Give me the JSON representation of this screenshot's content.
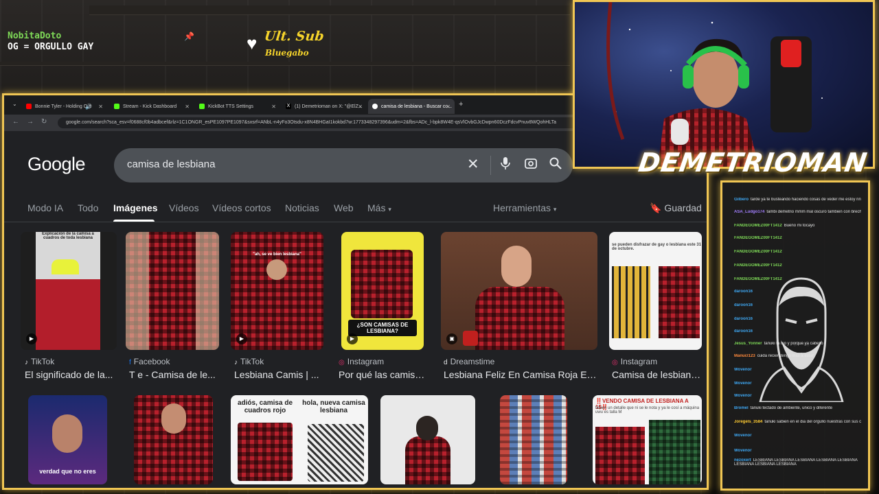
{
  "overlay": {
    "chat_user": "NobitaDoto",
    "chat_message": "OG = ORGULLO GAY",
    "ult_sub_label": "Ult. Sub",
    "ult_sub_name": "Bluegabo",
    "streamer_name": "DEMETRIOMAN",
    "colors": {
      "frame": "#f0c654",
      "chat_user": "#7ed957",
      "ult_sub": "#f6d42b"
    }
  },
  "browser": {
    "tabs": [
      {
        "title": "Bonnie Tyler - Holding Out",
        "icon": "youtube-icon",
        "color": "#ff0000"
      },
      {
        "title": "Stream - Kick Dashboard",
        "icon": "kick-icon",
        "color": "#53fc18"
      },
      {
        "title": "KickBot TTS Settings",
        "icon": "kickbot-icon",
        "color": "#53fc18"
      },
      {
        "title": "(1) Demetrioman on X: \"@ElZ...",
        "icon": "x-icon",
        "color": "#ffffff"
      },
      {
        "title": "camisa de lesbiana - Buscar co...",
        "icon": "google-icon",
        "color": "#4285f4"
      }
    ],
    "url": "google.com/search?sca_esv=f0688cf0b4adbcef&rlz=1C1ONGR_esPE1097PE1097&sxsrf=ANbL-n4yFo3Otsdu-x8N4BHGaI1kokbd7w:1773348297396&udm=2&fbs=ADc_l-bpk8W4E-qsVlOvbGJcDwpn60DczFdcvPnuv8WQohHLTa"
  },
  "google": {
    "logo": "Google",
    "query": "camisa de lesbiana",
    "nav_tabs": [
      "Modo IA",
      "Todo",
      "Imágenes",
      "Vídeos",
      "Vídeos cortos",
      "Noticias",
      "Web",
      "Más"
    ],
    "active_tab": "Imágenes",
    "tools_label": "Herramientas",
    "saved_label": "Guardad",
    "results_row1": [
      {
        "source": "TikTok",
        "source_icon": "tiktok-icon",
        "title": "El significado de la...",
        "caption": "Explicación de la camisa a cuadros de toda lesbiana"
      },
      {
        "source": "Facebook",
        "source_icon": "facebook-icon",
        "title": "T e - Camisa de le..."
      },
      {
        "source": "TikTok",
        "source_icon": "tiktok-icon",
        "title": "Lesbiana Camis | ...",
        "caption": "\"ah, se ve bien lesbiana\""
      },
      {
        "source": "Instagram",
        "source_icon": "instagram-icon",
        "title": "Por qué las camisa...",
        "caption": "¿SON CAMISAS DE LESBIANA?"
      },
      {
        "source": "Dreamstime",
        "source_icon": "dreamstime-icon",
        "title": "Lesbiana Feliz En Camisa Roja En..."
      },
      {
        "source": "Instagram",
        "source_icon": "instagram-icon",
        "title": "Camisa de lesbiana ...",
        "caption": "se pueden disfrazar de gay o lesbiana este 31 de octubre."
      }
    ],
    "results_row2": [
      {
        "caption": "verdad que no eres"
      },
      {
        "caption": ""
      },
      {
        "caption": "adiós, camisa de cuadros rojo",
        "caption2": "hola, nueva camisa lesbiana"
      },
      {
        "caption": ""
      },
      {
        "caption": ""
      },
      {
        "caption": "‼️VENDO CAMISA DE LESBIANA A 1$‼️",
        "caption2": "tienen un detalle que ni se le nota y ya le cosí a máquina uwu es talla M"
      }
    ]
  },
  "chat": {
    "lines": [
      {
        "user": "Gilbero",
        "text": "tarde ya te busteando haciendo cosas de veder me estoy rindo el problema"
      },
      {
        "user": "ASA_Ludgo174",
        "text": "tambi demetrio mmm mal oscuro tambien con brecha azul"
      },
      {
        "user": "FANDEGOMEZ00FT1412",
        "text": "Bueno mi tocayo"
      },
      {
        "user": "FANDEGOMEZ00FT1412",
        "text": ""
      },
      {
        "user": "FANDEGOMEZ00FT1412",
        "text": ""
      },
      {
        "user": "FANDEGOMEZ00FT1412",
        "text": ""
      },
      {
        "user": "FANDEGOMEZ00FT1412",
        "text": ""
      },
      {
        "user": "daroon16",
        "text": ""
      },
      {
        "user": "daroon16",
        "text": ""
      },
      {
        "user": "daroon16",
        "text": ""
      },
      {
        "user": "daroon16",
        "text": ""
      },
      {
        "user": "Jesus_Yonner",
        "text": "tanuki ta ojo y porque ya cabello"
      },
      {
        "user": "Manucl123",
        "text": "cuida recien tengo mas a estar"
      },
      {
        "user": "Wovenor",
        "text": ""
      },
      {
        "user": "Wovenor",
        "text": ""
      },
      {
        "user": "Wovenor",
        "text": ""
      },
      {
        "user": "Bromel",
        "text": "tanuki tectado de ambiente, unico y diferente"
      },
      {
        "user": "Joregels_3584",
        "text": "tanuki sabien en el dia del orgullo nuestras con sus camisa de adornadas?"
      },
      {
        "user": "Wovenor",
        "text": ""
      },
      {
        "user": "Wovenor",
        "text": ""
      },
      {
        "user": "nezoxert",
        "text": "LESBIANA LESBIANA LESBIANA LESBIANA LESBIANA LESBIANA LESBIANA LESBIANA"
      }
    ],
    "avatar_icon": "bearded-man-logo-icon"
  }
}
